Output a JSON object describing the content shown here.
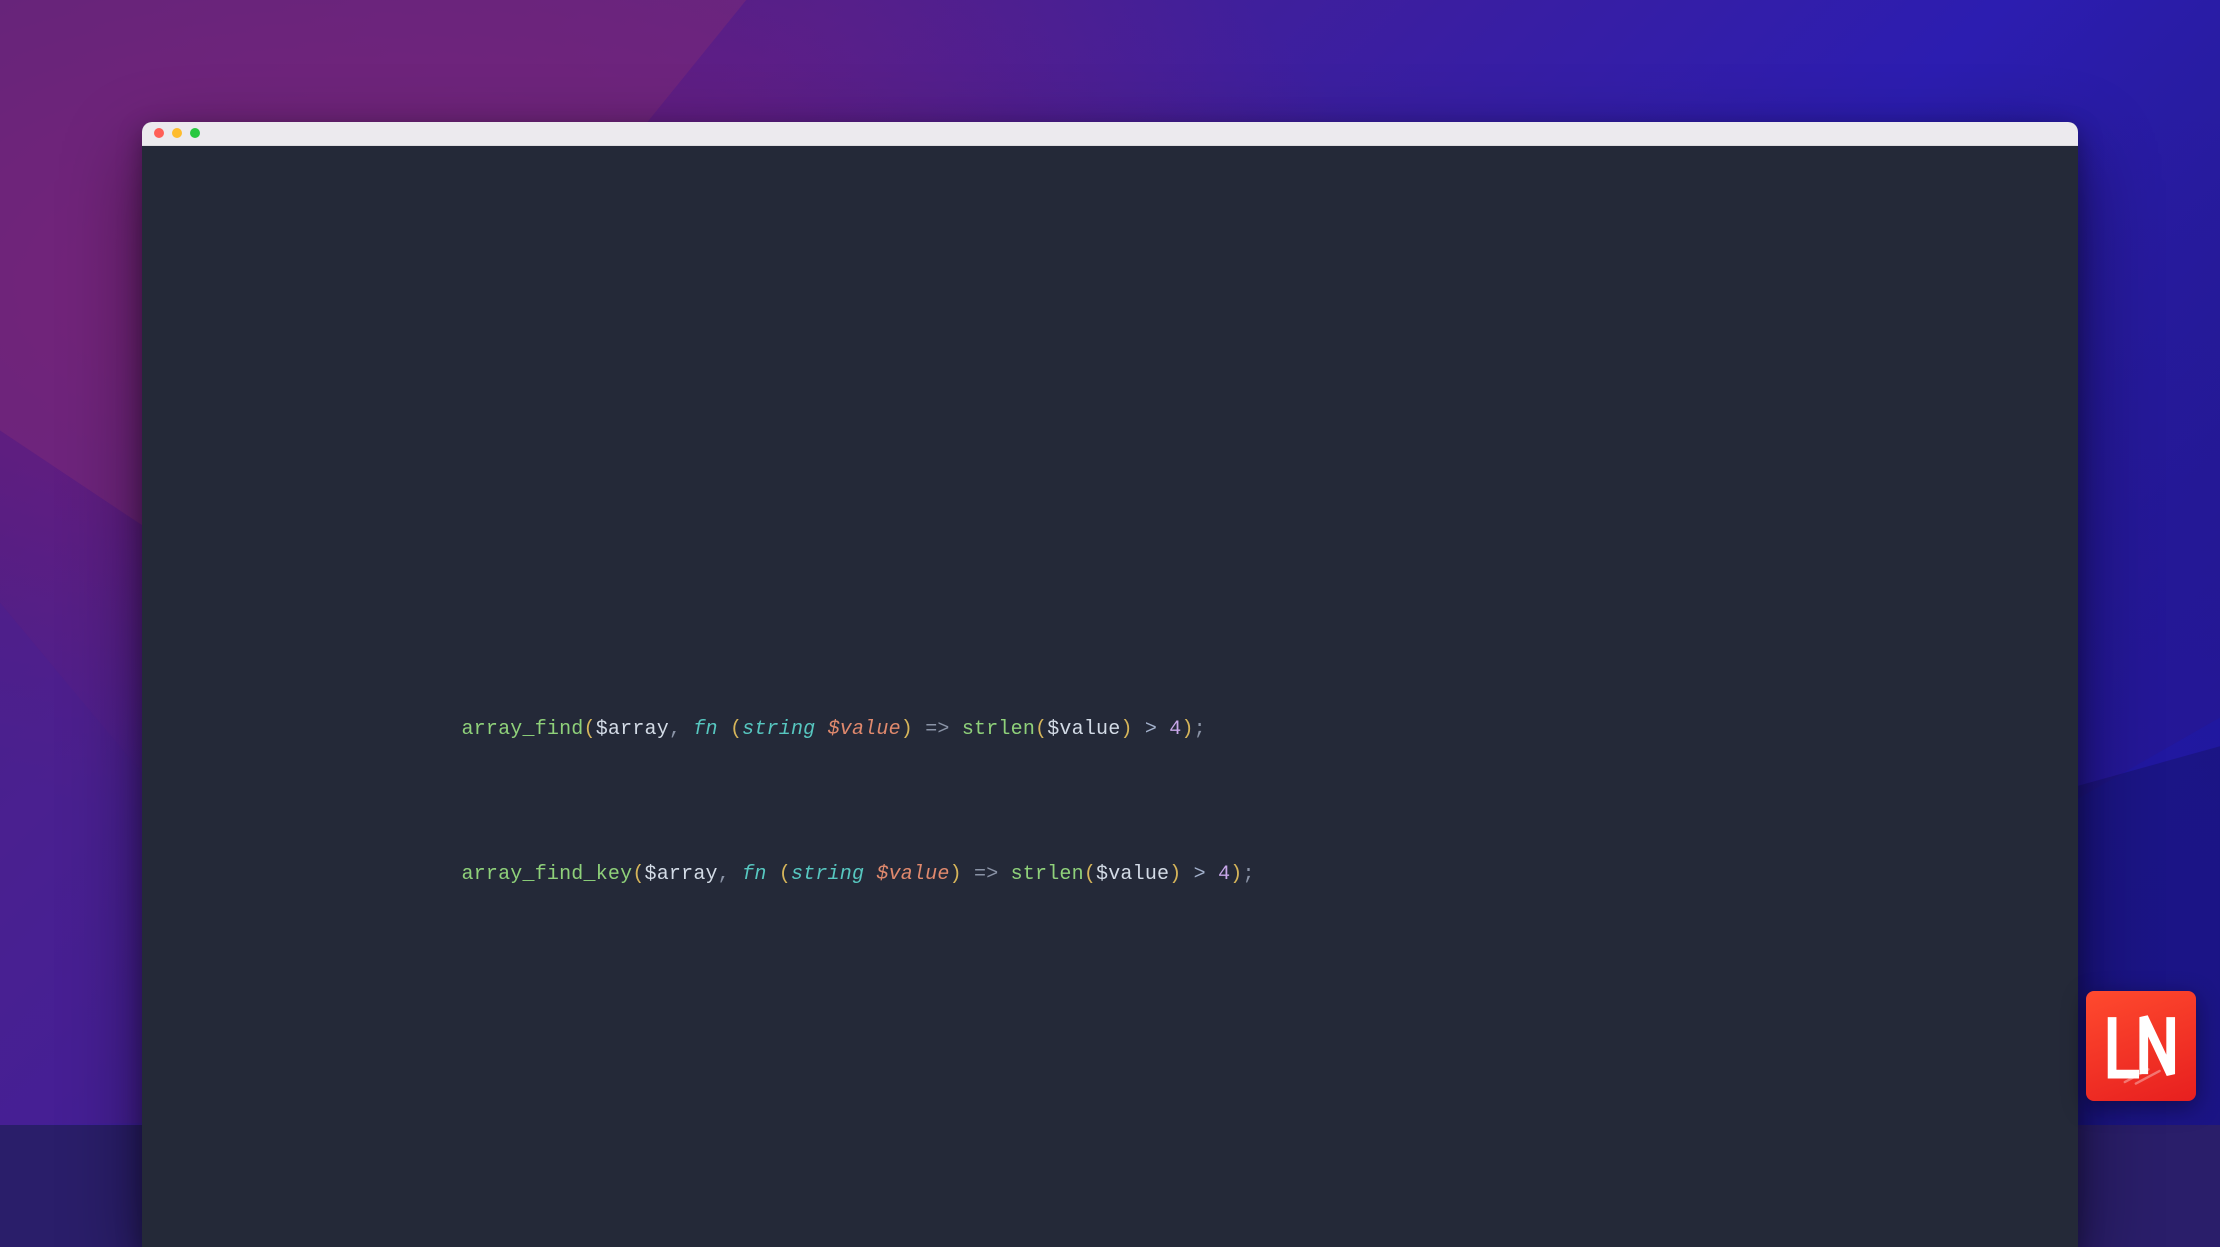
{
  "window": {
    "title": "",
    "traffic_lights": [
      "close",
      "minimize",
      "zoom"
    ]
  },
  "colors": {
    "editor_bg": "#242938",
    "titlebar_bg": "#eceaee",
    "traffic_close": "#ff5f57",
    "traffic_minimize": "#febc2e",
    "traffic_zoom": "#28c840",
    "func": "#8fd17a",
    "paren": "#d6b55a",
    "var": "#d3dbe6",
    "punct": "#8a93a6",
    "keyword": "#57c7c0",
    "param": "#e0896d",
    "operator": "#a3b1cc",
    "number": "#c7a6e8",
    "logo_bg_start": "#ff4a2e",
    "logo_bg_end": "#e71f1f"
  },
  "code": {
    "lines": [
      {
        "plain": "array_find($array, fn (string $value) => strlen($value) > 4);",
        "tokens": [
          {
            "t": "array_find",
            "c": "func"
          },
          {
            "t": "(",
            "c": "paren"
          },
          {
            "t": "$array",
            "c": "var"
          },
          {
            "t": ", ",
            "c": "punct"
          },
          {
            "t": "fn",
            "c": "fn"
          },
          {
            "t": " ",
            "c": "punct"
          },
          {
            "t": "(",
            "c": "paren"
          },
          {
            "t": "string",
            "c": "type"
          },
          {
            "t": " ",
            "c": "punct"
          },
          {
            "t": "$value",
            "c": "param"
          },
          {
            "t": ")",
            "c": "paren"
          },
          {
            "t": " => ",
            "c": "punct"
          },
          {
            "t": "strlen",
            "c": "func"
          },
          {
            "t": "(",
            "c": "paren"
          },
          {
            "t": "$value",
            "c": "var"
          },
          {
            "t": ")",
            "c": "paren"
          },
          {
            "t": " > ",
            "c": "op"
          },
          {
            "t": "4",
            "c": "num"
          },
          {
            "t": ")",
            "c": "paren"
          },
          {
            "t": ";",
            "c": "punct"
          }
        ]
      },
      {
        "plain": "array_find_key($array, fn (string $value) => strlen($value) > 4);",
        "tokens": [
          {
            "t": "array_find_key",
            "c": "func"
          },
          {
            "t": "(",
            "c": "paren"
          },
          {
            "t": "$array",
            "c": "var"
          },
          {
            "t": ", ",
            "c": "punct"
          },
          {
            "t": "fn",
            "c": "fn"
          },
          {
            "t": " ",
            "c": "punct"
          },
          {
            "t": "(",
            "c": "paren"
          },
          {
            "t": "string",
            "c": "type"
          },
          {
            "t": " ",
            "c": "punct"
          },
          {
            "t": "$value",
            "c": "param"
          },
          {
            "t": ")",
            "c": "paren"
          },
          {
            "t": " => ",
            "c": "punct"
          },
          {
            "t": "strlen",
            "c": "func"
          },
          {
            "t": "(",
            "c": "paren"
          },
          {
            "t": "$value",
            "c": "var"
          },
          {
            "t": ")",
            "c": "paren"
          },
          {
            "t": " > ",
            "c": "op"
          },
          {
            "t": "4",
            "c": "num"
          },
          {
            "t": ")",
            "c": "paren"
          },
          {
            "t": ";",
            "c": "punct"
          }
        ]
      }
    ]
  },
  "logo": {
    "text": "LN"
  }
}
